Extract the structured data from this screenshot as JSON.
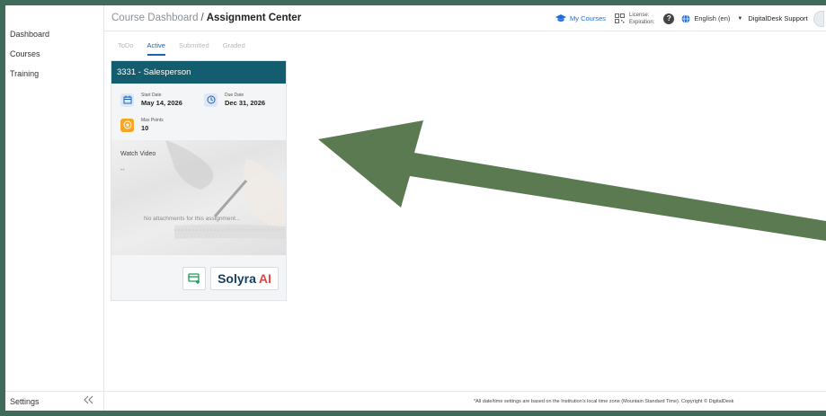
{
  "sidebar": {
    "items": [
      {
        "label": "Dashboard"
      },
      {
        "label": "Courses"
      },
      {
        "label": "Training"
      }
    ],
    "settings_label": "Settings",
    "collapse_icon": "double-chevron-left-icon"
  },
  "header": {
    "breadcrumb_parent": "Course Dashboard",
    "breadcrumb_separator": "/",
    "breadcrumb_current": "Assignment Center",
    "my_courses": "My Courses",
    "license_label": "License:",
    "expiration_label": "Expiration:",
    "help_glyph": "?",
    "language": "English (en)",
    "user": "DigitalDesk Support"
  },
  "tabs": [
    {
      "label": "ToDo",
      "active": false
    },
    {
      "label": "Active",
      "active": true
    },
    {
      "label": "Submitted",
      "active": false
    },
    {
      "label": "Graded",
      "active": false
    }
  ],
  "card": {
    "title": "3331 - Salesperson",
    "start_label": "Start Date",
    "start_value": "May 14, 2026",
    "due_label": "Due Date",
    "due_value": "Dec 31, 2026",
    "points_label": "Max Points",
    "points_value": "10",
    "video_label": "Watch Video",
    "video_dash": "--",
    "no_attachments": "No attachments for this assignment...",
    "brand_part1": "Solyra",
    "brand_part2": "AI"
  },
  "footer": {
    "text": "*All date/time settings are based on the Institution's local time zone (Mountain Standard Time).  Copyright © DigitalDesk"
  },
  "colors": {
    "frame": "#3f6b5a",
    "card_header": "#145d6e",
    "accent": "#1e5fb8",
    "arrow": "#5b7a52",
    "brand_red": "#e2473f",
    "brand_navy": "#163c5e"
  }
}
